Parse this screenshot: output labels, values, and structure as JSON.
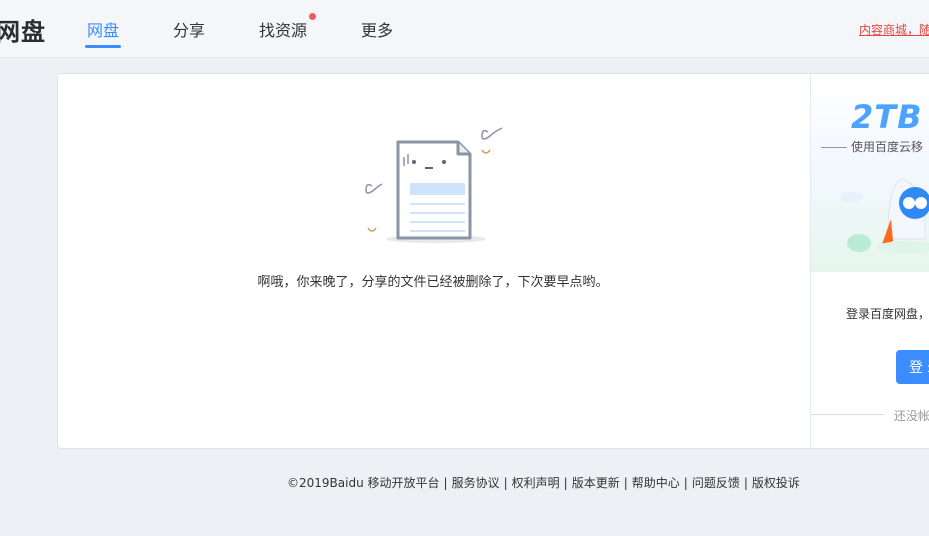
{
  "header": {
    "logo_text": "网盘",
    "nav": [
      {
        "label": "网盘",
        "active": true
      },
      {
        "label": "分享",
        "active": false
      },
      {
        "label": "找资源",
        "active": false,
        "badge": "red-dot"
      },
      {
        "label": "更多",
        "active": false
      }
    ],
    "promo_link": "内容商城，随"
  },
  "main": {
    "message": "啊哦，你来晚了，分享的文件已经被删除了，下次要早点哟。",
    "illustration_icon": "deleted-file-icon"
  },
  "side": {
    "promo_title": "2TB",
    "promo_subtitle": "使用百度云移",
    "login_text": "登录百度网盘，",
    "login_button": "登录",
    "register_text": "还没帐"
  },
  "footer": {
    "copyright": "©2019Baidu",
    "links": [
      "移动开放平台",
      "服务协议",
      "权利声明",
      "版本更新",
      "帮助中心",
      "问题反馈",
      "版权投诉"
    ]
  },
  "colors": {
    "accent": "#3b8cff",
    "badge": "#f05a5a",
    "promo_link": "#e5463f"
  }
}
